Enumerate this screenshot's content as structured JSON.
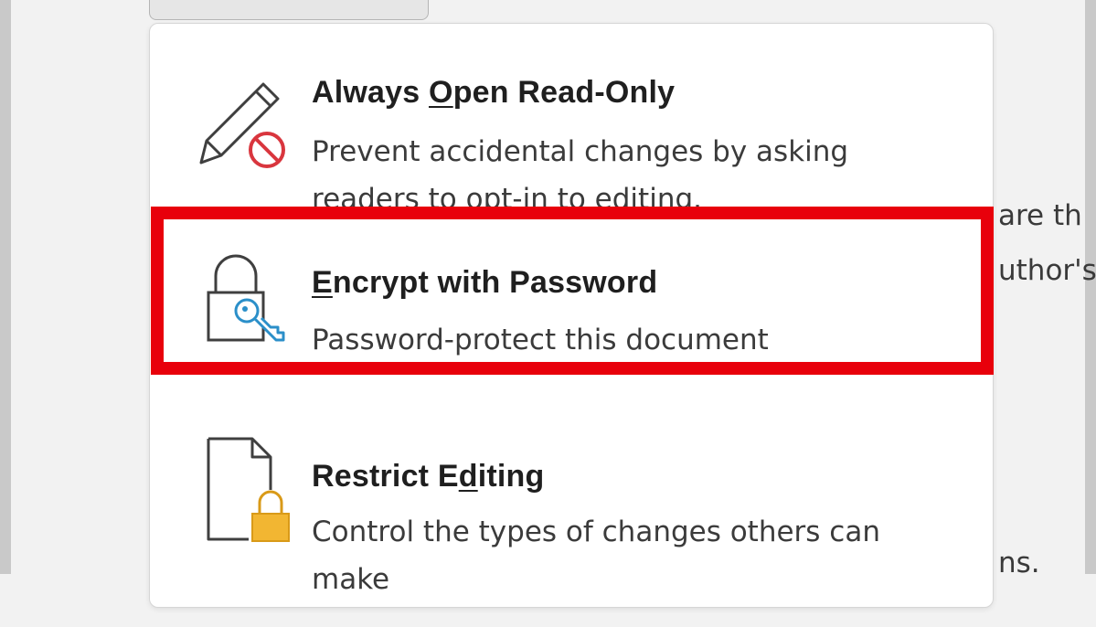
{
  "background": {
    "fragments": [
      "are th",
      "uthor's",
      "ns."
    ]
  },
  "menu": {
    "items": [
      {
        "title_before": "Always ",
        "title_accel": "O",
        "title_after": "pen Read-Only",
        "description": "Prevent accidental changes by asking readers to opt-in to editing.",
        "icon": "pencil-no-edit-icon"
      },
      {
        "title_before": "",
        "title_accel": "E",
        "title_after": "ncrypt with Password",
        "description": "Password-protect this document",
        "icon": "lock-key-icon"
      },
      {
        "title_before": "Restrict E",
        "title_accel": "d",
        "title_after": "iting",
        "description": "Control the types of changes others can make",
        "icon": "document-lock-icon"
      }
    ]
  },
  "colors": {
    "highlight": "#e8000b",
    "prohibit": "#d9363e",
    "key": "#2b8fc9",
    "lock": "#f2b632"
  }
}
